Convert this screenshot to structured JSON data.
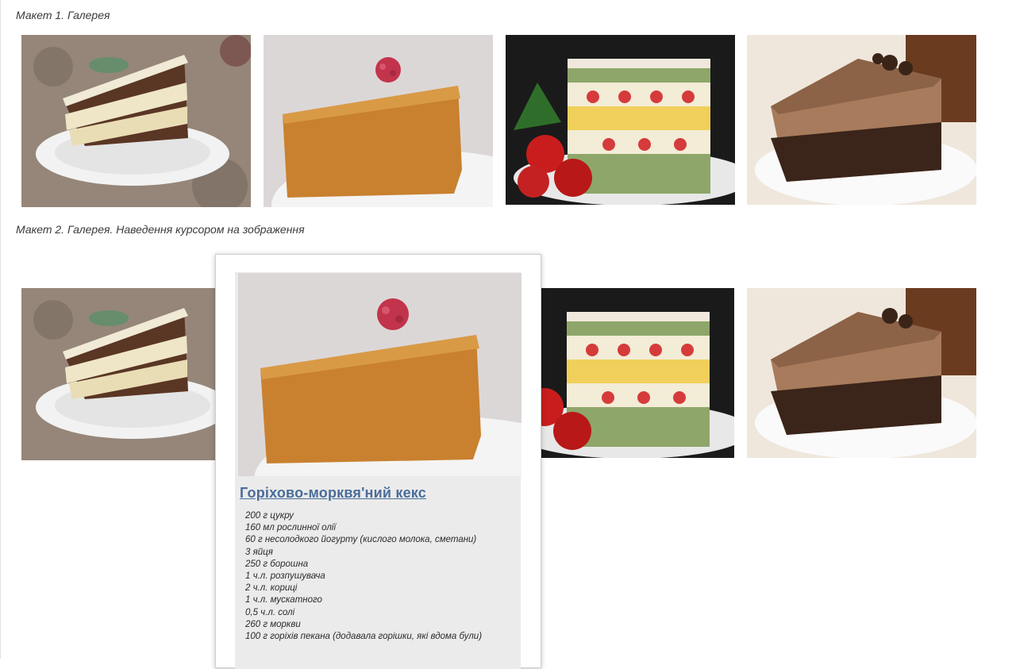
{
  "layout1": {
    "caption": "Макет 1. Галерея",
    "images": [
      "layered-cake-photo",
      "carrot-nut-cake-photo",
      "strawberry-cake-photo",
      "chocolate-mousse-cake-photo"
    ]
  },
  "layout2": {
    "caption": "Макет 2. Галерея. Наведення курсором на зображення",
    "popup": {
      "title": "Горіхово-морквя'ний кекс",
      "ingredients": [
        "200 г цукру",
        "160 мл рослинної олії",
        "60 г несолодкого йогурту (кислого молока, сметани)",
        "3 яйця",
        "250 г борошна",
        "1 ч.л. розпушувача",
        "2 ч.л. кориці",
        "1 ч.л. мускатного",
        "0,5 ч.л. солі",
        "260 г моркви",
        "100 г горіхів пекана (додавала горішки, які вдома були)"
      ]
    }
  },
  "colors": {
    "link": "#4a6d9a",
    "popup_bg": "#ebebeb"
  }
}
